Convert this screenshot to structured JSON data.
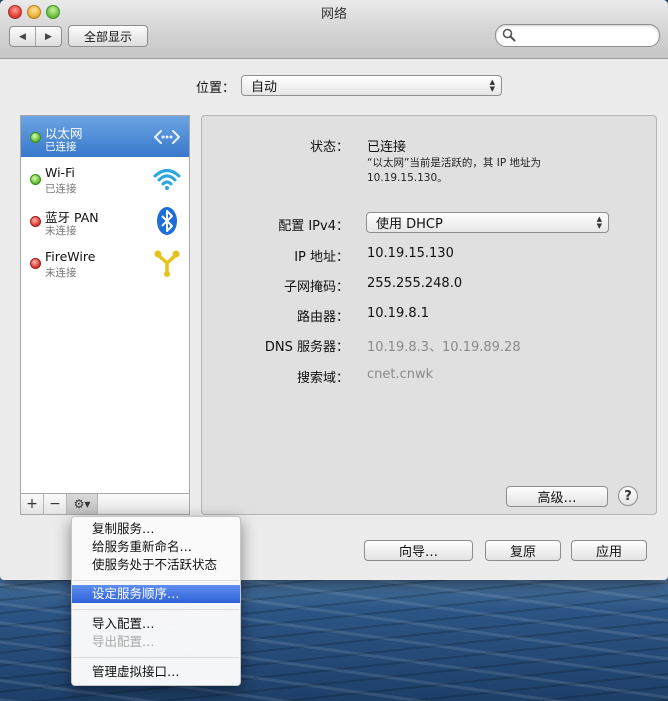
{
  "window": {
    "title": "网络"
  },
  "toolbar": {
    "back_icon": "◀",
    "forward_icon": "▶",
    "show_all_label": "全部显示",
    "search_placeholder": ""
  },
  "location": {
    "label": "位置：",
    "value": "自动"
  },
  "services": [
    {
      "name": "以太网",
      "status": "已连接",
      "state": "green",
      "icon": "ethernet-icon",
      "selected": true
    },
    {
      "name": "Wi-Fi",
      "status": "已连接",
      "state": "green",
      "icon": "wifi-icon",
      "selected": false
    },
    {
      "name": "蓝牙 PAN",
      "status": "未连接",
      "state": "red",
      "icon": "bluetooth-icon",
      "selected": false
    },
    {
      "name": "FireWire",
      "status": "未连接",
      "state": "red",
      "icon": "firewire-icon",
      "selected": false
    }
  ],
  "sidebar_toolbar": {
    "add": "+",
    "remove": "−",
    "gear": "⚙▾"
  },
  "detail": {
    "status_label": "状态：",
    "status_value": "已连接",
    "status_desc_line1": "“以太网”当前是活跃的，其 IP 地址为",
    "status_desc_line2": "10.19.15.130。",
    "ipv4_label": "配置 IPv4：",
    "ipv4_value": "使用 DHCP",
    "ip_label": "IP 地址：",
    "ip_value": "10.19.15.130",
    "mask_label": "子网掩码：",
    "mask_value": "255.255.248.0",
    "router_label": "路由器：",
    "router_value": "10.19.8.1",
    "dns_label": "DNS 服务器：",
    "dns_value": "10.19.8.3、10.19.89.28",
    "search_label": "搜索域：",
    "search_value": "cnet.cnwk",
    "advanced_label": "高级…",
    "help_label": "?"
  },
  "footer": {
    "assist_label": "向导…",
    "revert_label": "复原",
    "apply_label": "应用"
  },
  "context_menu": {
    "items": [
      {
        "label": "复制服务…",
        "state": "normal"
      },
      {
        "label": "给服务重新命名…",
        "state": "normal"
      },
      {
        "label": "使服务处于不活跃状态",
        "state": "normal"
      },
      {
        "label": "设定服务顺序…",
        "state": "highlighted"
      },
      {
        "label": "导入配置…",
        "state": "normal"
      },
      {
        "label": "导出配置…",
        "state": "disabled"
      },
      {
        "label": "管理虚拟接口…",
        "state": "normal"
      }
    ]
  },
  "colors": {
    "selection": "#3978cc",
    "menu_highlight": "#2f62d8",
    "connected": "#5ab524",
    "disconnected": "#d6322a"
  }
}
